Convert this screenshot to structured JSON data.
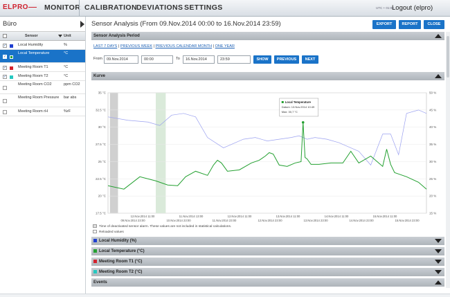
{
  "nav": {
    "logo": "ELPRO",
    "items": [
      "MONITOR",
      "CALIBRATION",
      "DEVIATIONS",
      "SETTINGS"
    ],
    "utc": "UTC + 01:00",
    "logout": "Logout (elpro)"
  },
  "sidebar": {
    "location": "Büro",
    "header": {
      "sensor": "Sensor",
      "unit": "Unit"
    },
    "sensors": [
      {
        "name": "Local Humidity",
        "unit": "%",
        "checked": true,
        "color": "#1f3fd0",
        "selected": false
      },
      {
        "name": "Local Temperature",
        "unit": "°C",
        "checked": true,
        "color": "#23a030",
        "selected": true
      },
      {
        "name": "Meeting Room T1",
        "unit": "°C",
        "checked": true,
        "color": "#d3212d",
        "selected": false
      },
      {
        "name": "Meeting Room T2",
        "unit": "°C",
        "checked": true,
        "color": "#25c8c0",
        "selected": false
      },
      {
        "name": "Meeting Room CO2",
        "unit": "ppm CO2",
        "checked": false,
        "color": "",
        "selected": false
      },
      {
        "name": "Meeting Room Pressure",
        "unit": "bar abs",
        "checked": false,
        "color": "",
        "selected": false
      },
      {
        "name": "Meeting Room rH",
        "unit": "%rF",
        "checked": false,
        "color": "",
        "selected": false
      }
    ]
  },
  "main": {
    "title": "Sensor Analysis (From 09.Nov.2014 00:00 to 16.Nov.2014 23:59)",
    "buttons": {
      "export": "EXPORT",
      "report": "REPORT",
      "close": "CLOSE"
    },
    "period_section": "Sensor Analysis Period",
    "quick_links": [
      "LAST 7 DAYS",
      "PREVIOUS WEEK",
      "PREVIOUS CALENDAR MONTH",
      "ONE YEAR"
    ],
    "from_label": "From",
    "from_date": "09.Nov.2014",
    "from_time": "00:00",
    "to_label": "To",
    "to_date": "16.Nov.2014",
    "to_time": "23:59",
    "show": "SHOW",
    "previous": "PREVIOUS",
    "next": "NEXT",
    "curve_section": "Kurve",
    "note1": "Time of deactivated sensor alarm. These values are not included in statistical calculations.",
    "note2": "Reloaded values",
    "collapsed_sections": [
      {
        "label": "Local Humidity (%)",
        "color": "#1f3fd0"
      },
      {
        "label": "Local Temperature (°C)",
        "color": "#23a030"
      },
      {
        "label": "Meeting Room T1 (°C)",
        "color": "#d3212d"
      },
      {
        "label": "Meeting Room T2 (°C)",
        "color": "#25c8c0"
      }
    ],
    "events_section": "Events"
  },
  "chart_data": {
    "type": "line",
    "y_left": {
      "ticks": [
        "17.5 °C",
        "20 °C",
        "22.5 °C",
        "25 °C",
        "27.5 °C",
        "30 °C",
        "32.5 °C",
        "35 °C"
      ],
      "ylim": [
        17.5,
        35
      ]
    },
    "y_right": {
      "ticks": [
        "15 %",
        "20 %",
        "25 %",
        "30 %",
        "35 %",
        "40 %",
        "45 %",
        "50 %"
      ],
      "ylim": [
        15,
        50
      ]
    },
    "x_ticks_top": [
      "12.Nov.2014 11:00",
      "11.Nov.2014 13:00",
      "12.Nov.2014 11:00",
      "13.Nov.2014 11:00",
      "14.Nov.2014 11:00",
      "15.Nov.2014 11:00"
    ],
    "x_ticks_bottom": [
      "09.Nov.2014 23:00",
      "10.Nov.2014 23:00",
      "11.Nov.2014 23:00",
      "12.Nov.2014 23:00",
      "13.Nov.2014 23:00",
      "14.Nov.2014 23:00",
      "15.Nov.2014 23:00"
    ],
    "x_days": [
      0,
      8
    ],
    "tooltip": {
      "title": "Local Temperature",
      "datum": "Datum: 13.Nov.2014 10:49",
      "max": "Max:    30,7 °C"
    },
    "deactivated_bands": [
      [
        0.05,
        0.25
      ],
      [
        1.2,
        1.45
      ]
    ],
    "series": [
      {
        "name": "Local Temperature",
        "color": "#23a030",
        "x": [
          0,
          0.4,
          0.8,
          1.2,
          1.5,
          1.75,
          1.95,
          2.2,
          2.5,
          2.65,
          2.75,
          2.85,
          3.0,
          3.3,
          3.6,
          3.8,
          3.95,
          4.05,
          4.15,
          4.3,
          4.5,
          4.7,
          4.85,
          4.9,
          4.95,
          5.0,
          5.1,
          5.3,
          5.6,
          5.9,
          6.1,
          6.3,
          6.6,
          6.9,
          7.0,
          7.1,
          7.2,
          7.3,
          7.5,
          7.8,
          8.0
        ],
        "values": [
          21.5,
          21.0,
          22.8,
          22.2,
          21.6,
          21.5,
          22.8,
          23.6,
          23.0,
          24.5,
          25.2,
          24.8,
          23.6,
          23.8,
          24.8,
          25.2,
          25.8,
          26.3,
          26.1,
          24.5,
          24.3,
          24.8,
          25.0,
          30.7,
          25.6,
          25.4,
          24.6,
          24.6,
          24.8,
          24.8,
          26.5,
          24.8,
          25.8,
          24.3,
          26.8,
          24.6,
          23.4,
          23.2,
          22.8,
          22.0,
          21.0
        ]
      },
      {
        "name": "Local Humidity",
        "color": "#9aa0f0",
        "x": [
          0,
          0.5,
          1.0,
          1.3,
          1.6,
          1.9,
          2.2,
          2.5,
          2.9,
          3.2,
          3.4,
          3.7,
          4.0,
          4.3,
          4.6,
          4.8,
          5.0,
          5.2,
          5.5,
          5.8,
          6.1,
          6.3,
          6.6,
          6.9,
          7.1,
          7.3,
          7.5,
          7.8,
          8.0
        ],
        "values": [
          43,
          42,
          41.5,
          40.5,
          43.5,
          44,
          43,
          37,
          34,
          35.5,
          36.5,
          37,
          36,
          36.5,
          37,
          37.5,
          36.5,
          37,
          36.5,
          35.5,
          34,
          33,
          29,
          38,
          38,
          32,
          44,
          45,
          44
        ]
      }
    ]
  }
}
